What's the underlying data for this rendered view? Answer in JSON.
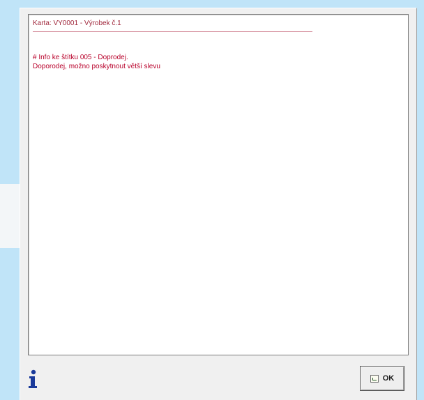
{
  "note": {
    "card_title": "Karta: VY0001 - Výrobek č.1",
    "lines": [
      "# Info ke štítku 005 - Doprodej.",
      "Doporodej, možno poskytnout větší slevu"
    ]
  },
  "footer": {
    "info_icon": "info-icon",
    "ok_label": "OK",
    "ok_icon": "confirm-icon"
  },
  "colors": {
    "background": "#c0e4f8",
    "dialog": "#f0f0f0",
    "text_red": "#b8002a",
    "icon_blue": "#1a3a9a"
  }
}
